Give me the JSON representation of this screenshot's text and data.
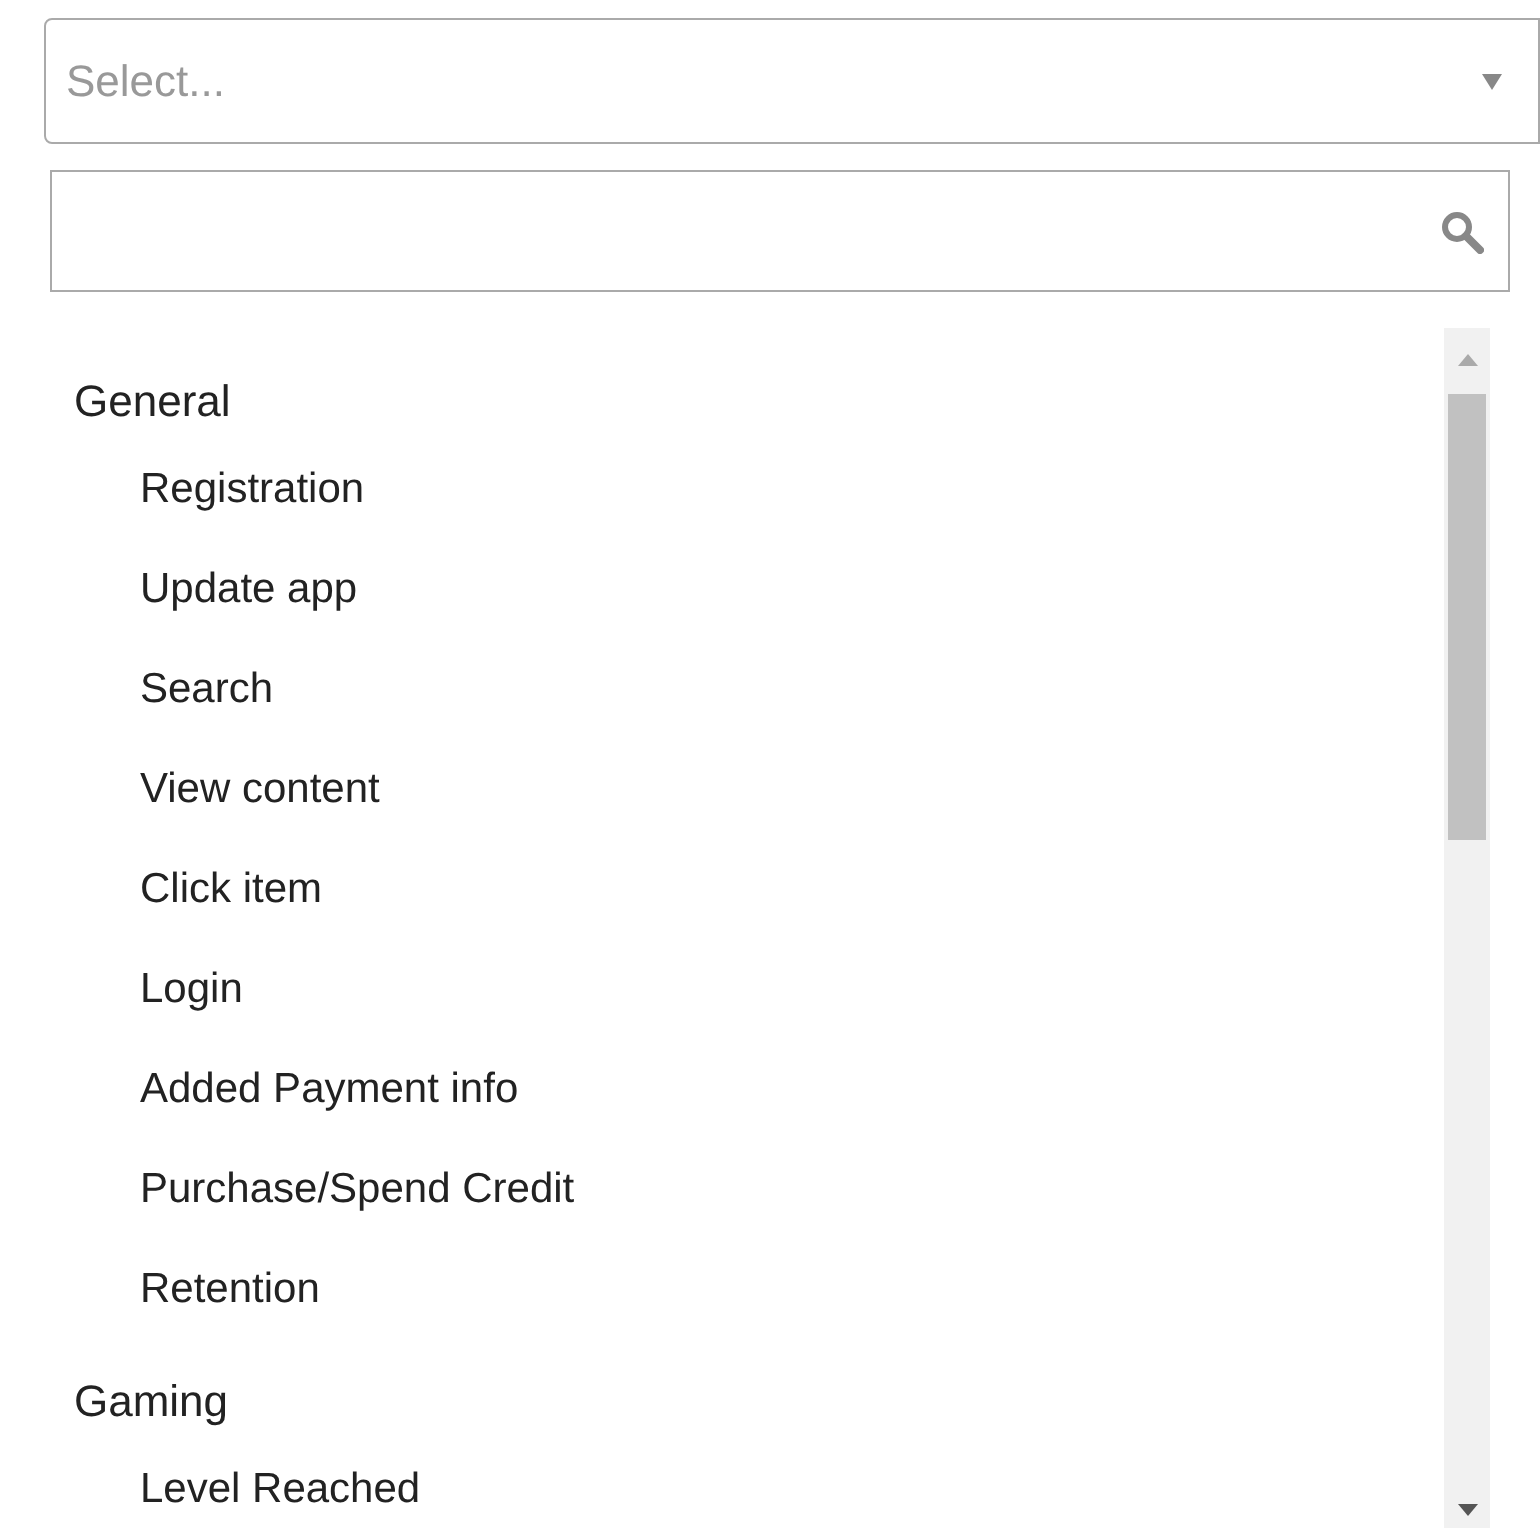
{
  "select": {
    "placeholder": "Select..."
  },
  "groups": [
    {
      "label": "General",
      "items": [
        "Registration",
        "Update app",
        "Search",
        "View content",
        "Click item",
        "Login",
        "Added Payment info",
        "Purchase/Spend Credit",
        "Retention"
      ]
    },
    {
      "label": "Gaming",
      "items": [
        "Level Reached"
      ]
    }
  ]
}
